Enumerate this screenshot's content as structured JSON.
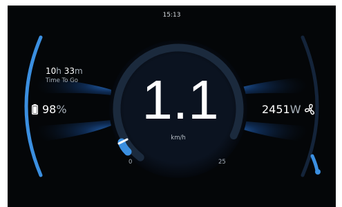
{
  "status_bar": {
    "clock": "15:13"
  },
  "time_to_go": {
    "hours": "10",
    "hours_unit": "h",
    "minutes": "33",
    "minutes_unit": "m",
    "label": "Time To Go"
  },
  "battery": {
    "value": "98",
    "unit": "%",
    "icon": "battery-icon"
  },
  "speedometer": {
    "speed": "1.1",
    "unit": "km/h",
    "min_label": "0",
    "max_label": "25",
    "min": 0,
    "max": 25,
    "value": 1.1
  },
  "power": {
    "value": "2451",
    "unit": "W",
    "icon": "fan-icon"
  },
  "colors": {
    "background": "#040608",
    "accent_blue": "#3b8fe0",
    "glow_blue": "#1e6ad0",
    "track": "#1b2a3d",
    "text_primary": "#ffffff",
    "text_secondary": "#a9b2bb"
  }
}
